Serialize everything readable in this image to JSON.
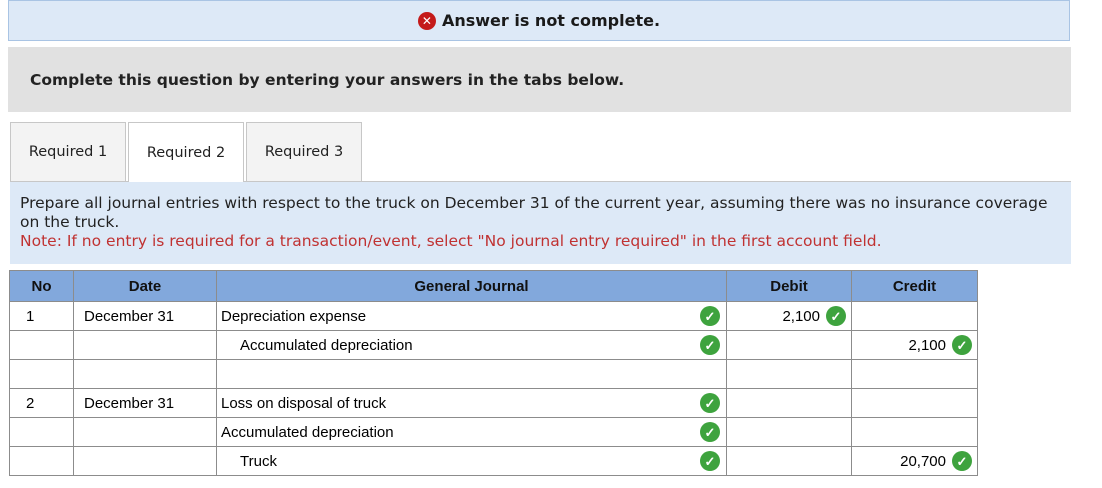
{
  "banner": {
    "text": "Answer is not complete.",
    "icon": "x-icon",
    "icon_glyph": "✕"
  },
  "instructions": "Complete this question by entering your answers in the tabs below.",
  "tabs": [
    {
      "label": "Required 1"
    },
    {
      "label": "Required 2",
      "active": true
    },
    {
      "label": "Required 3"
    }
  ],
  "prompt": {
    "text": "Prepare all journal entries with respect to the truck on December 31 of the current year, assuming there was no insurance coverage on the truck.",
    "note": "Note: If no entry is required for a transaction/event, select \"No journal entry required\" in the first account field."
  },
  "journal": {
    "headers": {
      "no": "No",
      "date": "Date",
      "general_journal": "General Journal",
      "debit": "Debit",
      "credit": "Credit"
    },
    "check_glyph": "✓",
    "rows": [
      {
        "no": "1",
        "date": "December 31",
        "account": "Depreciation expense",
        "debit": "2,100",
        "credit": ""
      },
      {
        "no": "",
        "date": "",
        "account": "Accumulated depreciation",
        "debit": "",
        "credit": "2,100"
      },
      {
        "no": "",
        "date": "",
        "account": "",
        "debit": "",
        "credit": ""
      },
      {
        "no": "2",
        "date": "December 31",
        "account": "Loss on disposal of truck",
        "debit": "",
        "credit": ""
      },
      {
        "no": "",
        "date": "",
        "account": "Accumulated depreciation",
        "debit": "",
        "credit": ""
      },
      {
        "no": "",
        "date": "",
        "account": "Truck",
        "debit": "",
        "credit": "20,700"
      }
    ]
  },
  "colors": {
    "header_bg": "#82a8dc",
    "check_green": "#3ea33e",
    "error_red": "#c41a1a",
    "note_red": "#c03232",
    "info_bg": "#dde9f7"
  }
}
